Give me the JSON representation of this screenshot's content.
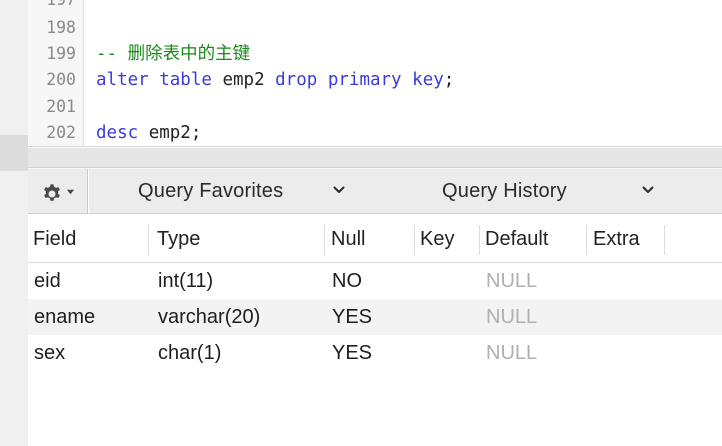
{
  "editor": {
    "lines": [
      {
        "num": "197",
        "segments": []
      },
      {
        "num": "198",
        "segments": []
      },
      {
        "num": "199",
        "segments": [
          {
            "text": "-- 删除表中的主键",
            "kind": "comment"
          }
        ]
      },
      {
        "num": "200",
        "segments": [
          {
            "text": "alter",
            "kind": "kw"
          },
          {
            "text": " ",
            "kind": "plain"
          },
          {
            "text": "table",
            "kind": "kw"
          },
          {
            "text": " emp2 ",
            "kind": "plain"
          },
          {
            "text": "drop",
            "kind": "kw"
          },
          {
            "text": " ",
            "kind": "plain"
          },
          {
            "text": "primary",
            "kind": "kw"
          },
          {
            "text": " ",
            "kind": "plain"
          },
          {
            "text": "key",
            "kind": "kw"
          },
          {
            "text": ";",
            "kind": "plain"
          }
        ]
      },
      {
        "num": "201",
        "segments": []
      },
      {
        "num": "202",
        "segments": [
          {
            "text": "desc",
            "kind": "kw"
          },
          {
            "text": " emp2;",
            "kind": "plain"
          }
        ]
      }
    ]
  },
  "toolbar": {
    "gear_icon": "gear-icon",
    "favorites_label": "Query Favorites",
    "history_label": "Query History"
  },
  "results": {
    "columns": [
      "Field",
      "Type",
      "Null",
      "Key",
      "Default",
      "Extra"
    ],
    "rows": [
      [
        "eid",
        "int(11)",
        "NO",
        "",
        "NULL",
        ""
      ],
      [
        "ename",
        "varchar(20)",
        "YES",
        "",
        "NULL",
        ""
      ],
      [
        "sex",
        "char(1)",
        "YES",
        "",
        "NULL",
        ""
      ]
    ]
  },
  "colors": {
    "keyword": "#3b3bd6",
    "comment": "#1a8a1a",
    "null_value": "#b0b0b0"
  }
}
